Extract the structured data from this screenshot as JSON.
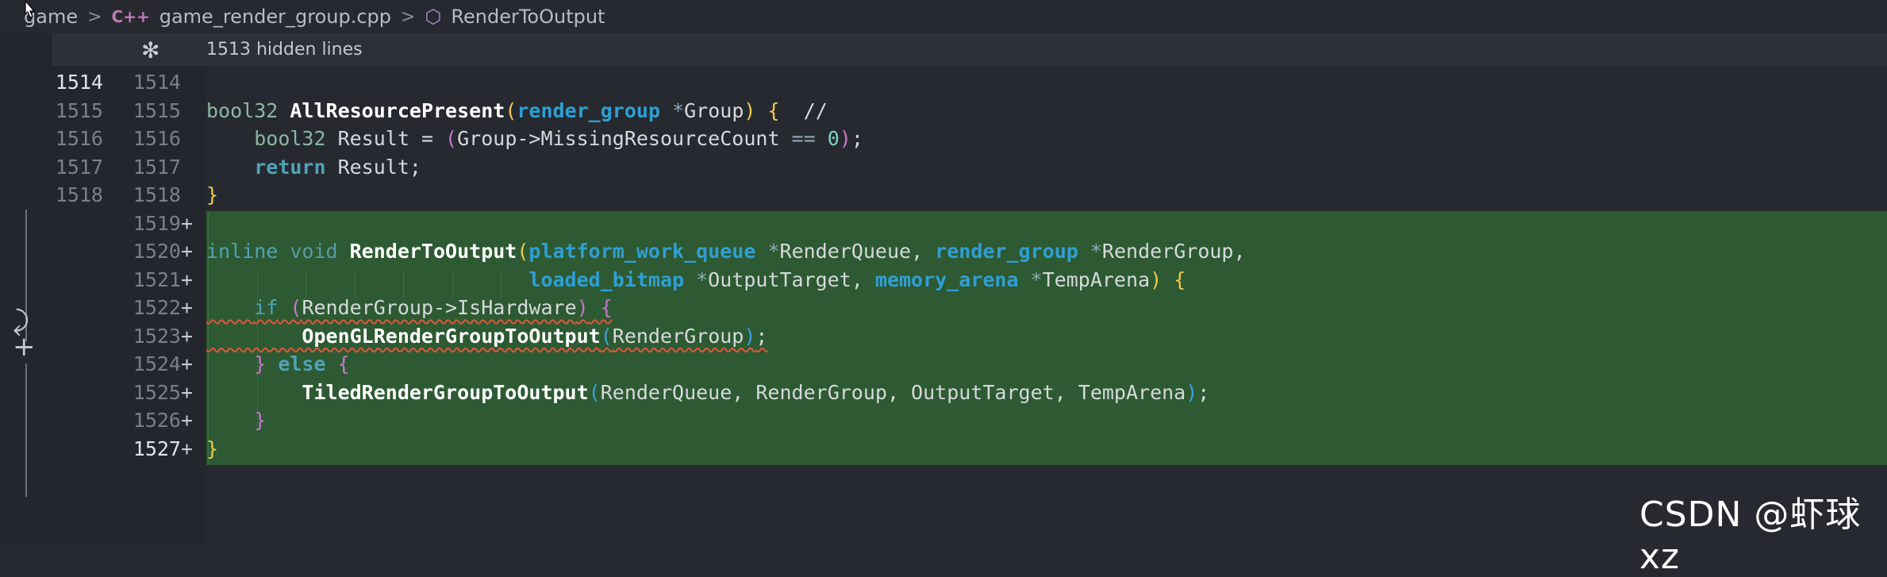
{
  "breadcrumb": {
    "items": [
      "game",
      "game_render_group.cpp",
      "RenderToOutput"
    ],
    "sep": ">",
    "cpp_icon": "C++"
  },
  "hidden_bar": {
    "label": "1513 hidden lines",
    "icon": "unfold-icon"
  },
  "lines": [
    {
      "old": "1514",
      "new": "1514",
      "plus": ""
    },
    {
      "old": "1515",
      "new": "1515",
      "plus": ""
    },
    {
      "old": "1516",
      "new": "1516",
      "plus": ""
    },
    {
      "old": "1517",
      "new": "1517",
      "plus": ""
    },
    {
      "old": "1518",
      "new": "1518",
      "plus": ""
    },
    {
      "old": "",
      "new": "1519",
      "plus": "+"
    },
    {
      "old": "",
      "new": "1520",
      "plus": "+"
    },
    {
      "old": "",
      "new": "1521",
      "plus": "+"
    },
    {
      "old": "",
      "new": "1522",
      "plus": "+"
    },
    {
      "old": "",
      "new": "1523",
      "plus": "+"
    },
    {
      "old": "",
      "new": "1524",
      "plus": "+"
    },
    {
      "old": "",
      "new": "1525",
      "plus": "+"
    },
    {
      "old": "",
      "new": "1526",
      "plus": "+"
    },
    {
      "old": "",
      "new": "1527",
      "plus": "+"
    }
  ],
  "code": {
    "l1515": {
      "t1": "bool32",
      "f": "AllResourcePresent",
      "p1": "(",
      "k1": "render_group",
      "s1": " *",
      "a1": "Group",
      "p2": ")",
      "sp": " ",
      "b1": "{",
      "c": "  //"
    },
    "l1516": {
      "t1": "bool32",
      "a1": " Result = ",
      "p1": "(",
      "a2": "Group->MissingResourceCount ",
      "o": "==",
      "n": " 0",
      "p2": ")",
      "a3": ";"
    },
    "l1517": {
      "k": "return",
      "a": " Result;"
    },
    "l1518": {
      "b": "}"
    },
    "l1520": {
      "k1": "inline",
      "k2": " void",
      "f": " RenderToOutput",
      "p1": "(",
      "k3": "platform_work_queue",
      "s1": " *",
      "a1": "RenderQueue, ",
      "k4": "render_group",
      "s2": " *",
      "a2": "RenderGroup,"
    },
    "l1521": {
      "k1": "loaded_bitmap",
      "s1": " *",
      "a1": "OutputTarget, ",
      "k2": "memory_arena",
      "s2": " *",
      "a2": "TempArena",
      "p1": ")",
      "b": " {"
    },
    "l1522": {
      "k": "if",
      "p1": " (",
      "a": "RenderGroup->IsHardware",
      "p2": ")",
      "b": " {"
    },
    "l1523": {
      "f": "OpenGLRenderGroupToOutput",
      "p1": "(",
      "a": "RenderGroup",
      "p2": ")",
      "e": ";"
    },
    "l1524": {
      "b1": "}",
      "k": " else",
      "b2": " {"
    },
    "l1525": {
      "f": "TiledRenderGroupToOutput",
      "p1": "(",
      "a": "RenderQueue, RenderGroup, OutputTarget, TempArena",
      "p2": ")",
      "e": ";"
    },
    "l1526": {
      "b": "}"
    },
    "l1527": {
      "b": "}"
    }
  },
  "watermark": "CSDN @虾球xz"
}
